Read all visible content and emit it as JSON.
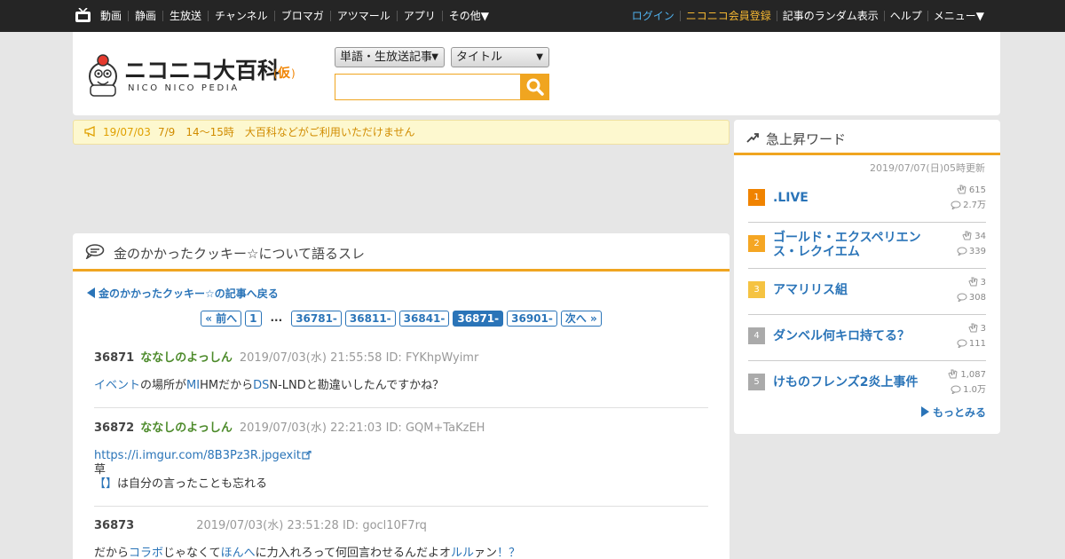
{
  "topnav": {
    "left": [
      "動画",
      "静画",
      "生放送",
      "チャンネル",
      "ブロマガ",
      "アツマール",
      "アプリ",
      "その他▼"
    ],
    "right": [
      "ログイン",
      "ニコニコ会員登録",
      "記事のランダム表示",
      "ヘルプ",
      "メニュー▼"
    ]
  },
  "header": {
    "logo_text": "ニコニコ大百科",
    "logo_sub": "NICO NICO PEDIA",
    "logo_badge": "仮",
    "select_category": "単語・生放送記事",
    "select_field": "タイトル",
    "search_value": ""
  },
  "notice": {
    "date": "19/07/03",
    "message": "7/9　14～15時　大百科などがご利用いただけません"
  },
  "thread": {
    "title": "金のかかったクッキー☆について語るスレ",
    "back_link": "金のかかったクッキー☆の記事へ戻る",
    "pager": [
      "« 前へ",
      "1",
      "...",
      "36781-",
      "36811-",
      "36841-",
      "36871-",
      "36901-",
      "次へ »"
    ],
    "pager_current": "36871-",
    "posts": [
      {
        "number": "36871",
        "name": "ななしのよっしん",
        "meta": "2019/07/03(水) 21:55:58 ID: FYKhpWyimr",
        "segments": [
          {
            "t": "イベント",
            "link": true
          },
          {
            "t": "の場所が",
            "link": false
          },
          {
            "t": "MI",
            "link": true
          },
          {
            "t": "HMだから",
            "link": false
          },
          {
            "t": "DS",
            "link": true
          },
          {
            "t": "N-LNDと勘違いしたんですかね？",
            "link": false
          }
        ]
      },
      {
        "number": "36872",
        "name": "ななしのよっしん",
        "meta": "2019/07/03(水) 22:21:03 ID: GQM+TaKzEH",
        "url": "https://i.imgur.com/8B3Pz3R.jpgexit",
        "line2": "草",
        "line3_link": "【】",
        "line3": "は自分の言ったことも忘れる"
      },
      {
        "number": "36873",
        "name": "",
        "meta": "2019/07/03(水) 23:51:28 ID: gocl10F7rq",
        "segments": [
          {
            "t": "だから",
            "link": false
          },
          {
            "t": "コラボ",
            "link": true
          },
          {
            "t": "じゃなくて",
            "link": false
          },
          {
            "t": "ほんへ",
            "link": true
          },
          {
            "t": "に力入れろって何回言わせるんだよオ",
            "link": false
          },
          {
            "t": "ルル",
            "link": true
          },
          {
            "t": "ァン",
            "link": false
          },
          {
            "t": "！？",
            "link": true
          }
        ]
      }
    ]
  },
  "trending": {
    "title": "急上昇ワード",
    "updated": "2019/07/07(日)05時更新",
    "more": "もっとみる",
    "items": [
      {
        "rank": "1",
        "word": ".LIVE",
        "likes": "615",
        "comments": "2.7万",
        "color": "#f08300"
      },
      {
        "rank": "2",
        "word": "ゴールド・エクスペリエンス・レクイエム",
        "likes": "34",
        "comments": "339",
        "color": "#f5a623"
      },
      {
        "rank": "3",
        "word": "アマリリス組",
        "likes": "3",
        "comments": "308",
        "color": "#f5c342"
      },
      {
        "rank": "4",
        "word": "ダンベル何キロ持てる？",
        "likes": "3",
        "comments": "111",
        "color": "#aaaaaa"
      },
      {
        "rank": "5",
        "word": "けものフレンズ2炎上事件",
        "likes": "1,087",
        "comments": "1.0万",
        "color": "#aaaaaa"
      }
    ]
  }
}
